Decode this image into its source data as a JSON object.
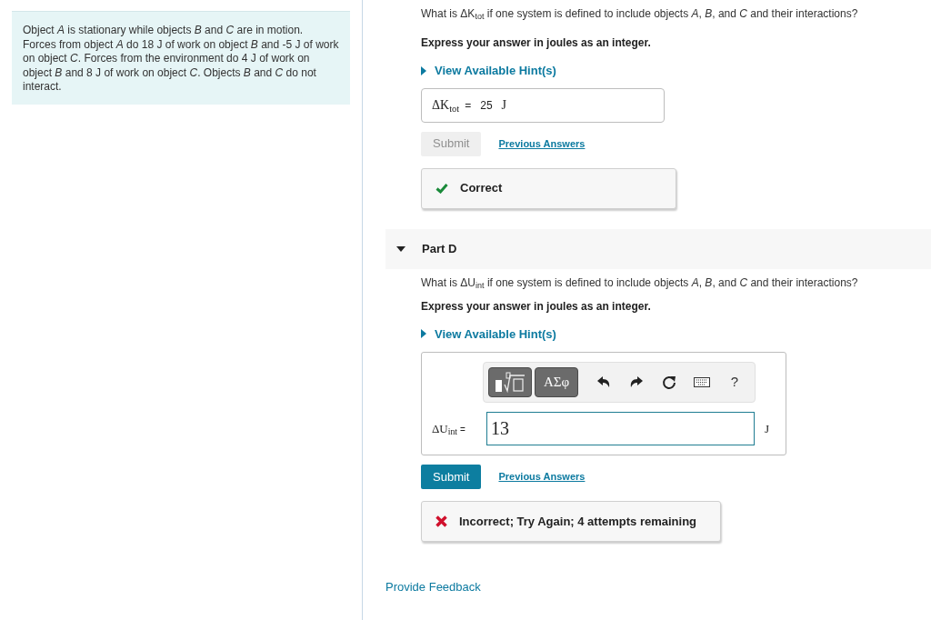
{
  "problem": "Object *A* is stationary while objects *B* and *C* are in motion. Forces from object *A* do 18 J of work on object *B* and -5 J of work on object *C*. Forces from the environment do 4 J of work on object *B* and 8 J of work on object *C*. Objects *B* and *C* do not interact.",
  "previous_part": {
    "question": "What is ΔK$_{tot}$ if one system is defined to include objects *A*, *B*, and *C* and their interactions?",
    "instruction": "Express your answer in joules as an integer.",
    "hint_link": "View Available Hint(s)",
    "answer": {
      "label": "ΔK$_{tot}$",
      "equals": "=",
      "value": "25",
      "unit": "J"
    },
    "submit": {
      "label": "Submit",
      "disabled": true
    },
    "previous_answers": "Previous Answers",
    "feedback": {
      "kind": "correct",
      "text": "Correct"
    }
  },
  "part_d": {
    "title": "Part D",
    "expanded": true,
    "question": "What is ΔU$_{int}$ if one system is defined to include objects *A*, *B*, and *C* and their interactions?",
    "instruction": "Express your answer in joules as an integer.",
    "hint_link": "View Available Hint(s)",
    "toolbar": [
      {
        "kind": "templates"
      },
      {
        "kind": "symbols",
        "label": "ΑΣφ"
      },
      {
        "kind": "undo"
      },
      {
        "kind": "redo"
      },
      {
        "kind": "reset"
      },
      {
        "kind": "keyboard"
      },
      {
        "kind": "help",
        "label": "?"
      }
    ],
    "answer": {
      "label": "ΔU$_{int}$",
      "equals": "=",
      "value": "13",
      "unit": "J"
    },
    "submit": {
      "label": "Submit",
      "disabled": false
    },
    "previous_answers": "Previous Answers",
    "feedback": {
      "kind": "incorrect",
      "text": "Incorrect; Try Again; 4 attempts remaining"
    }
  },
  "feedback_link": "Provide Feedback"
}
